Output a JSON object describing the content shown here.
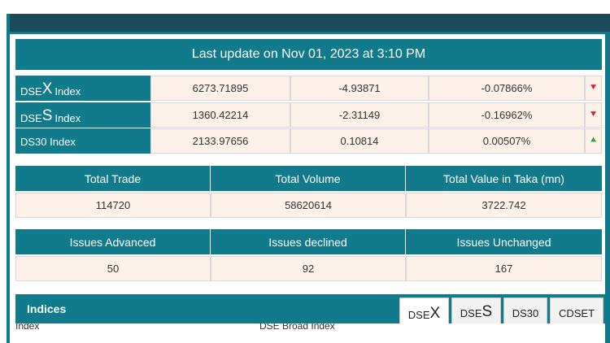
{
  "header": {
    "last_update": "Last update on Nov 01, 2023 at 3:10 PM"
  },
  "indices_summary": [
    {
      "name_big": "DSE",
      "name_letter": "X",
      "name_suffix": "Index",
      "value": "6273.71895",
      "change": "-4.93871",
      "percent": "-0.07866%",
      "direction": "down"
    },
    {
      "name_big": "DSE",
      "name_letter": "S",
      "name_suffix": "Index",
      "value": "1360.42214",
      "change": "-2.31149",
      "percent": "-0.16962%",
      "direction": "down"
    },
    {
      "name_big": "DS30 Index",
      "name_letter": "",
      "name_suffix": "",
      "value": "2133.97656",
      "change": "0.10814",
      "percent": "0.00507%",
      "direction": "up"
    }
  ],
  "trade_stats": {
    "headers": [
      "Total Trade",
      "Total Volume",
      "Total Value in Taka (mn)"
    ],
    "values": [
      "114720",
      "58620614",
      "3722.742"
    ]
  },
  "issue_stats": {
    "headers": [
      "Issues Advanced",
      "Issues declined",
      "Issues Unchanged"
    ],
    "values": [
      "50",
      "92",
      "167"
    ]
  },
  "indices_panel": {
    "title": "Indices",
    "tabs": [
      {
        "prefix": "DSE",
        "letter": "X"
      },
      {
        "prefix": "DSE",
        "letter": "S"
      },
      {
        "prefix": "DS30",
        "letter": ""
      },
      {
        "prefix": "CDSET",
        "letter": ""
      }
    ],
    "columns": [
      "Index",
      "DSE Broad Index"
    ]
  },
  "colors": {
    "teal": "#117a8b",
    "cell_bg": "#fdf1ea",
    "down": "#d9212c",
    "up": "#3a9d3a"
  }
}
